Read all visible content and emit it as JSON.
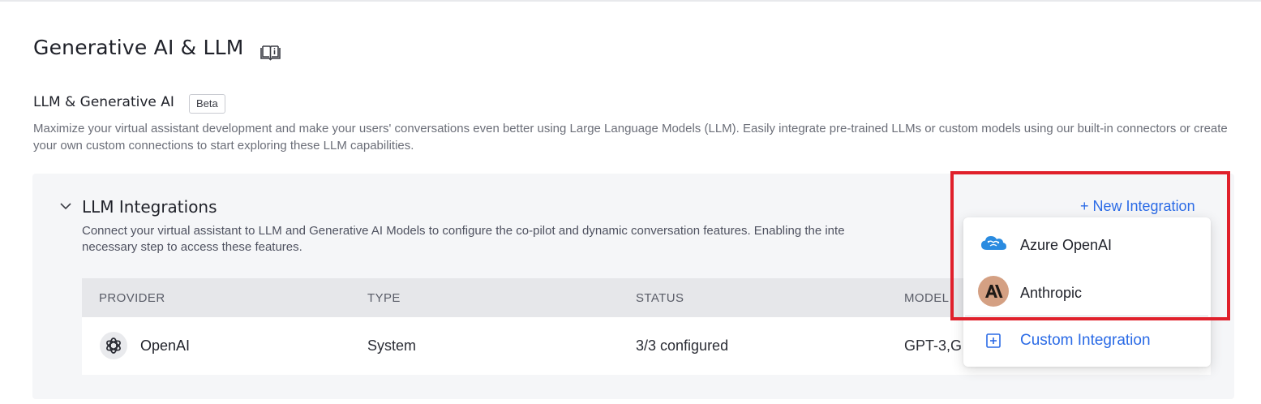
{
  "page": {
    "title": "Generative AI & LLM",
    "doc_icon": "book-icon"
  },
  "section": {
    "title": "LLM & Generative AI",
    "badge": "Beta",
    "description": "Maximize your virtual assistant development and make your users' conversations even better using Large Language Models (LLM). Easily integrate pre-trained LLMs or custom models using our built-in connectors or create your own custom connections to start exploring these LLM capabilities."
  },
  "integrations_panel": {
    "title": "LLM Integrations",
    "description": "Connect your virtual assistant to LLM and Generative AI Models to configure the co-pilot and dynamic conversation features. Enabling the inte",
    "description_line2": "necessary step to access these features.",
    "new_integration_label": "+ New Integration",
    "table": {
      "headers": [
        "PROVIDER",
        "TYPE",
        "STATUS",
        "MODEL"
      ],
      "rows": [
        {
          "provider": "OpenAI",
          "type": "System",
          "status": "3/3 configured",
          "model": "GPT-3,G"
        }
      ]
    }
  },
  "new_integration_menu": {
    "items": [
      {
        "label": "Azure OpenAI",
        "icon": "azure-openai-icon"
      },
      {
        "label": "Anthropic",
        "icon": "anthropic-icon"
      }
    ],
    "custom": {
      "label": "Custom Integration",
      "icon": "plus-square-icon"
    }
  },
  "colors": {
    "accent": "#2b6be6",
    "highlight": "#e0202b",
    "panel_bg": "#f5f6f8",
    "table_header_bg": "#e6e7ea"
  }
}
